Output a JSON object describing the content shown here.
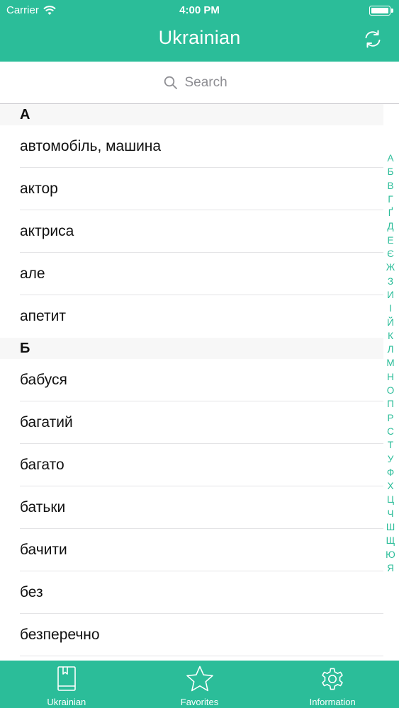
{
  "status_bar": {
    "carrier": "Carrier",
    "time": "4:00 PM"
  },
  "nav": {
    "title": "Ukrainian",
    "right_icon": "sync-icon"
  },
  "search": {
    "placeholder": "Search",
    "icon": "search-icon"
  },
  "sections": [
    {
      "header": "А",
      "items": [
        "автомобіль, машина",
        "актор",
        "актриса",
        "але",
        "апетит"
      ]
    },
    {
      "header": "Б",
      "items": [
        "бабуся",
        "багатий",
        "багато",
        "батьки",
        "бачити",
        "без",
        "безперечно"
      ]
    }
  ],
  "index_letters": [
    "А",
    "Б",
    "В",
    "Г",
    "Ґ",
    "Д",
    "Е",
    "Є",
    "Ж",
    "З",
    "И",
    "І",
    "Й",
    "К",
    "Л",
    "М",
    "Н",
    "О",
    "П",
    "Р",
    "С",
    "Т",
    "У",
    "Ф",
    "Х",
    "Ц",
    "Ч",
    "Ш",
    "Щ",
    "Ю",
    "Я"
  ],
  "tabs": [
    {
      "label": "Ukrainian",
      "icon": "book-icon"
    },
    {
      "label": "Favorites",
      "icon": "star-icon"
    },
    {
      "label": "Information",
      "icon": "gear-icon"
    }
  ],
  "colors": {
    "accent": "#2bbd99",
    "section_bg": "#f7f7f7",
    "separator": "#e4e4e6",
    "placeholder": "#8e8e93"
  }
}
